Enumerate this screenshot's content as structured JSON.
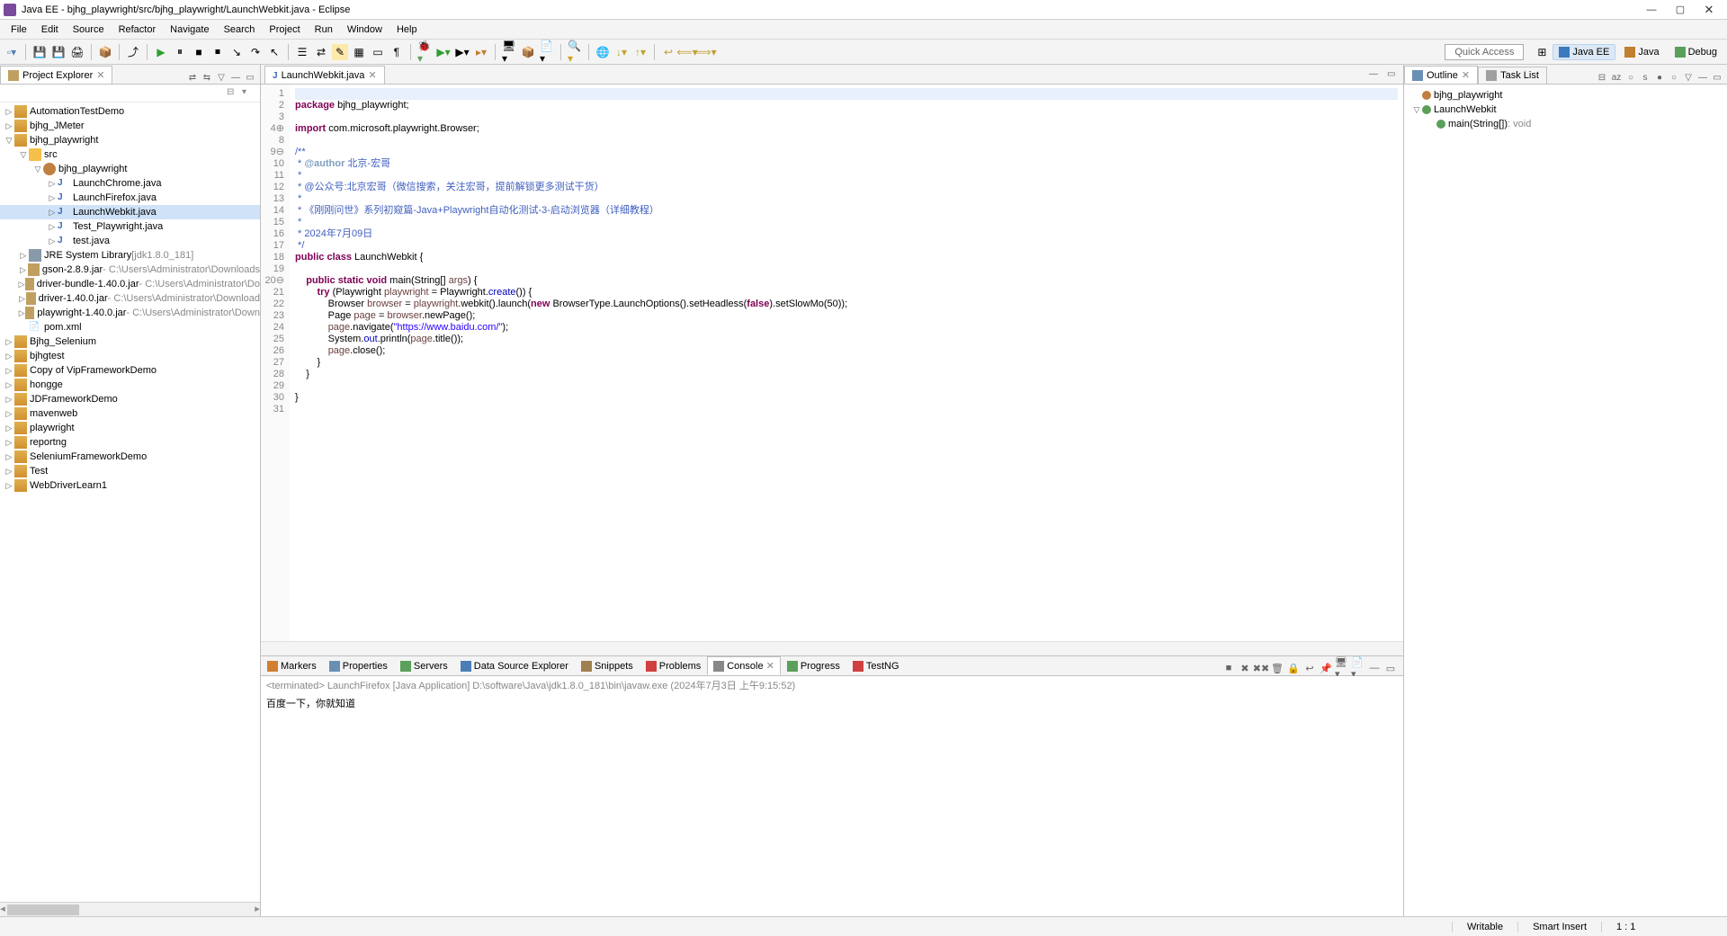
{
  "window": {
    "title": "Java EE - bjhg_playwright/src/bjhg_playwright/LaunchWebkit.java - Eclipse"
  },
  "menu": [
    "File",
    "Edit",
    "Source",
    "Refactor",
    "Navigate",
    "Search",
    "Project",
    "Run",
    "Window",
    "Help"
  ],
  "quick_access": "Quick Access",
  "perspectives": {
    "active": "Java EE",
    "others": [
      "Java",
      "Debug"
    ]
  },
  "project_explorer": {
    "title": "Project Explorer",
    "items": [
      {
        "d": 0,
        "exp": "▷",
        "type": "proj",
        "label": "AutomationTestDemo"
      },
      {
        "d": 0,
        "exp": "▷",
        "type": "proj",
        "label": "bjhg_JMeter"
      },
      {
        "d": 0,
        "exp": "▽",
        "type": "proj",
        "label": "bjhg_playwright"
      },
      {
        "d": 1,
        "exp": "▽",
        "type": "folder",
        "label": "src"
      },
      {
        "d": 2,
        "exp": "▽",
        "type": "pkg",
        "label": "bjhg_playwright"
      },
      {
        "d": 3,
        "exp": "▷",
        "type": "java",
        "label": "LaunchChrome.java"
      },
      {
        "d": 3,
        "exp": "▷",
        "type": "java",
        "label": "LaunchFirefox.java"
      },
      {
        "d": 3,
        "exp": "▷",
        "type": "java",
        "label": "LaunchWebkit.java",
        "selected": true
      },
      {
        "d": 3,
        "exp": "▷",
        "type": "java",
        "label": "Test_Playwright.java"
      },
      {
        "d": 3,
        "exp": "▷",
        "type": "java",
        "label": "test.java"
      },
      {
        "d": 1,
        "exp": "▷",
        "type": "lib",
        "label": "JRE System Library",
        "suffix": "[jdk1.8.0_181]"
      },
      {
        "d": 1,
        "exp": "▷",
        "type": "jar",
        "label": "gson-2.8.9.jar",
        "suffix": " - C:\\Users\\Administrator\\Downloads"
      },
      {
        "d": 1,
        "exp": "▷",
        "type": "jar",
        "label": "driver-bundle-1.40.0.jar",
        "suffix": " - C:\\Users\\Administrator\\Do"
      },
      {
        "d": 1,
        "exp": "▷",
        "type": "jar",
        "label": "driver-1.40.0.jar",
        "suffix": " - C:\\Users\\Administrator\\Download"
      },
      {
        "d": 1,
        "exp": "▷",
        "type": "jar",
        "label": "playwright-1.40.0.jar",
        "suffix": " - C:\\Users\\Administrator\\Down"
      },
      {
        "d": 1,
        "exp": "",
        "type": "xml",
        "label": "pom.xml"
      },
      {
        "d": 0,
        "exp": "▷",
        "type": "proj",
        "label": "Bjhg_Selenium",
        "err": true
      },
      {
        "d": 0,
        "exp": "▷",
        "type": "proj",
        "label": "bjhgtest"
      },
      {
        "d": 0,
        "exp": "▷",
        "type": "proj",
        "label": "Copy of VipFrameworkDemo"
      },
      {
        "d": 0,
        "exp": "▷",
        "type": "proj",
        "label": "hongge"
      },
      {
        "d": 0,
        "exp": "▷",
        "type": "proj",
        "label": "JDFrameworkDemo"
      },
      {
        "d": 0,
        "exp": "▷",
        "type": "proj",
        "label": "mavenweb"
      },
      {
        "d": 0,
        "exp": "▷",
        "type": "proj",
        "label": "playwright"
      },
      {
        "d": 0,
        "exp": "▷",
        "type": "proj",
        "label": "reportng"
      },
      {
        "d": 0,
        "exp": "▷",
        "type": "proj",
        "label": "SeleniumFrameworkDemo"
      },
      {
        "d": 0,
        "exp": "▷",
        "type": "proj",
        "label": "Test"
      },
      {
        "d": 0,
        "exp": "▷",
        "type": "proj",
        "label": "WebDriverLearn1"
      }
    ]
  },
  "editor": {
    "tab": "LaunchWebkit.java",
    "lines": [
      {
        "n": "1",
        "html": "<span class=\"hl\"> </span>"
      },
      {
        "n": "2",
        "html": "<span class=\"kw\">package</span> bjhg_playwright;"
      },
      {
        "n": "3",
        "html": ""
      },
      {
        "n": "4⊕",
        "html": "<span class=\"kw\">import</span> com.microsoft.playwright.Browser;"
      },
      {
        "n": "8",
        "html": ""
      },
      {
        "n": "9⊖",
        "html": "<span class=\"doc\">/**</span>"
      },
      {
        "n": "10",
        "html": "<span class=\"doc\"> * </span><span class=\"tag\">@author</span><span class=\"doc\"> 北京-宏哥</span>"
      },
      {
        "n": "11",
        "html": "<span class=\"doc\"> *</span>"
      },
      {
        "n": "12",
        "html": "<span class=\"doc\"> * @公众号:北京宏哥（微信搜索，关注宏哥，提前解锁更多测试干货）</span>"
      },
      {
        "n": "13",
        "html": "<span class=\"doc\"> *</span>"
      },
      {
        "n": "14",
        "html": "<span class=\"doc\"> * 《刚刚问世》系列初窥篇-Java+Playwright自动化测试-3-启动浏览器（详细教程）</span>"
      },
      {
        "n": "15",
        "html": "<span class=\"doc\"> *</span>"
      },
      {
        "n": "16",
        "html": "<span class=\"doc\"> * 2024年7月09日</span>"
      },
      {
        "n": "17",
        "html": "<span class=\"doc\"> */</span>"
      },
      {
        "n": "18",
        "html": "<span class=\"kw\">public</span> <span class=\"kw\">class</span> LaunchWebkit {"
      },
      {
        "n": "19",
        "html": ""
      },
      {
        "n": "20⊖",
        "html": "    <span class=\"kw\">public</span> <span class=\"kw\">static</span> <span class=\"kw\">void</span> main(String[] <span class=\"var\">args</span>) {"
      },
      {
        "n": "21",
        "html": "        <span class=\"kw\">try</span> (Playwright <span class=\"var\">playwright</span> = Playwright.<span class=\"fld\">create</span>()) {"
      },
      {
        "n": "22",
        "html": "            Browser <span class=\"var\">browser</span> = <span class=\"var\">playwright</span>.webkit().launch(<span class=\"kw\">new</span> BrowserType.LaunchOptions().setHeadless(<span class=\"kw\">false</span>).setSlowMo(50));"
      },
      {
        "n": "23",
        "html": "            Page <span class=\"var\">page</span> = <span class=\"var\">browser</span>.newPage();"
      },
      {
        "n": "24",
        "html": "            <span class=\"var\">page</span>.navigate(<span class=\"str\">\"https://www.baidu.com/\"</span>);"
      },
      {
        "n": "25",
        "html": "            System.<span class=\"fld\">out</span>.println(<span class=\"var\">page</span>.title());"
      },
      {
        "n": "26",
        "html": "            <span class=\"var\">page</span>.close();"
      },
      {
        "n": "27",
        "html": "        }"
      },
      {
        "n": "28",
        "html": "    }"
      },
      {
        "n": "29",
        "html": ""
      },
      {
        "n": "30",
        "html": "}"
      },
      {
        "n": "31",
        "html": ""
      }
    ]
  },
  "bottom": {
    "tabs": [
      "Markers",
      "Properties",
      "Servers",
      "Data Source Explorer",
      "Snippets",
      "Problems",
      "Console",
      "Progress",
      "TestNG"
    ],
    "active": 6,
    "console_header": "<terminated> LaunchFirefox [Java Application] D:\\software\\Java\\jdk1.8.0_181\\bin\\javaw.exe (2024年7月3日 上午9:15:52)",
    "console_body": "百度一下，你就知道"
  },
  "outline": {
    "tabs": [
      "Outline",
      "Task List"
    ],
    "items": [
      {
        "d": 0,
        "icon": "pkg",
        "label": "bjhg_playwright"
      },
      {
        "d": 0,
        "icon": "class",
        "label": "LaunchWebkit",
        "exp": "▽"
      },
      {
        "d": 1,
        "icon": "method",
        "label": "main(String[])",
        "suffix": " : void"
      }
    ]
  },
  "status": {
    "writable": "Writable",
    "insert": "Smart Insert",
    "pos": "1 : 1"
  }
}
